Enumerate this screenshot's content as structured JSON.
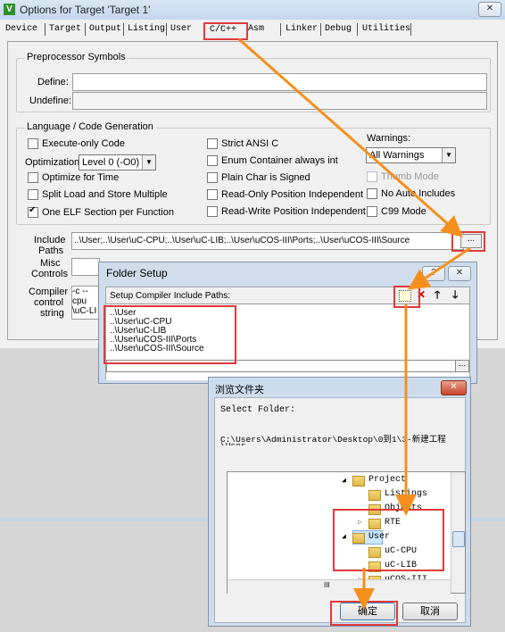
{
  "window": {
    "title": "Options for Target 'Target 1'",
    "app_icon": "keil-icon",
    "close": "✕"
  },
  "tabs": [
    "Device",
    "Target",
    "Output",
    "Listing",
    "User",
    "C/C++",
    "Asm",
    "Linker",
    "Debug",
    "Utilities"
  ],
  "preproc": {
    "legend": "Preprocessor Symbols",
    "define_label": "Define:",
    "define_value": "",
    "undefine_label": "Undefine:",
    "undefine_value": ""
  },
  "lang": {
    "legend": "Language / Code Generation",
    "execute_only": "Execute-only Code",
    "opt_label": "Optimization:",
    "opt_value": "Level 0 (-O0)",
    "optimize_time": "Optimize for Time",
    "split_load": "Split Load and Store Multiple",
    "one_elf": "One ELF Section per Function",
    "strict_ansi": "Strict ANSI C",
    "enum_container": "Enum Container always int",
    "plain_char": "Plain Char is Signed",
    "ro_pi": "Read-Only Position Independent",
    "rw_pi": "Read-Write Position Independent",
    "warnings_label": "Warnings:",
    "warnings_value": "All Warnings",
    "thumb_mode": "Thumb Mode",
    "no_auto_includes": "No Auto Includes",
    "c99": "C99 Mode"
  },
  "include": {
    "label1": "Include",
    "label2": "Paths",
    "value": "..\\User;..\\User\\uC-CPU;..\\User\\uC-LIB;..\\User\\uCOS-III\\Ports;..\\User\\uCOS-III\\Source",
    "browse": "..."
  },
  "misc": {
    "label1": "Misc",
    "label2": "Controls",
    "value": ""
  },
  "compiler": {
    "label1": "Compiler",
    "label2": "control",
    "label3": "string",
    "line1": "-c --cpu",
    "line2": "\\uC-LI"
  },
  "folder_setup": {
    "title": "Folder Setup",
    "help": "?",
    "close": "✕",
    "heading": "Setup Compiler Include Paths:",
    "paths": [
      "..\\User",
      "..\\User\\uC-CPU",
      "..\\User\\uC-LIB",
      "..\\User\\uCOS-III\\Ports",
      "..\\User\\uCOS-III\\Source"
    ],
    "browse": "..."
  },
  "browse": {
    "title": "浏览文件夹",
    "close": "✕",
    "select_label": "Select Folder:",
    "path": "C:\\Users\\Administrator\\Desktop\\0到1\\3-新建工程",
    "path2": "\\User",
    "tree": [
      {
        "name": "Project",
        "expander": "◢"
      },
      {
        "name": "Listings",
        "expander": ""
      },
      {
        "name": "Objects",
        "expander": ""
      },
      {
        "name": "RTE",
        "expander": "▷"
      },
      {
        "name": "User",
        "expander": "◢"
      },
      {
        "name": "uC-CPU",
        "expander": ""
      },
      {
        "name": "uC-LIB",
        "expander": ""
      },
      {
        "name": "uCOS-III",
        "expander": "▷"
      }
    ],
    "scroll_label": "III",
    "ok": "确定",
    "cancel": "取消"
  },
  "colors": {
    "highlight": "#e03a3a",
    "arrow": "#f5901e"
  }
}
